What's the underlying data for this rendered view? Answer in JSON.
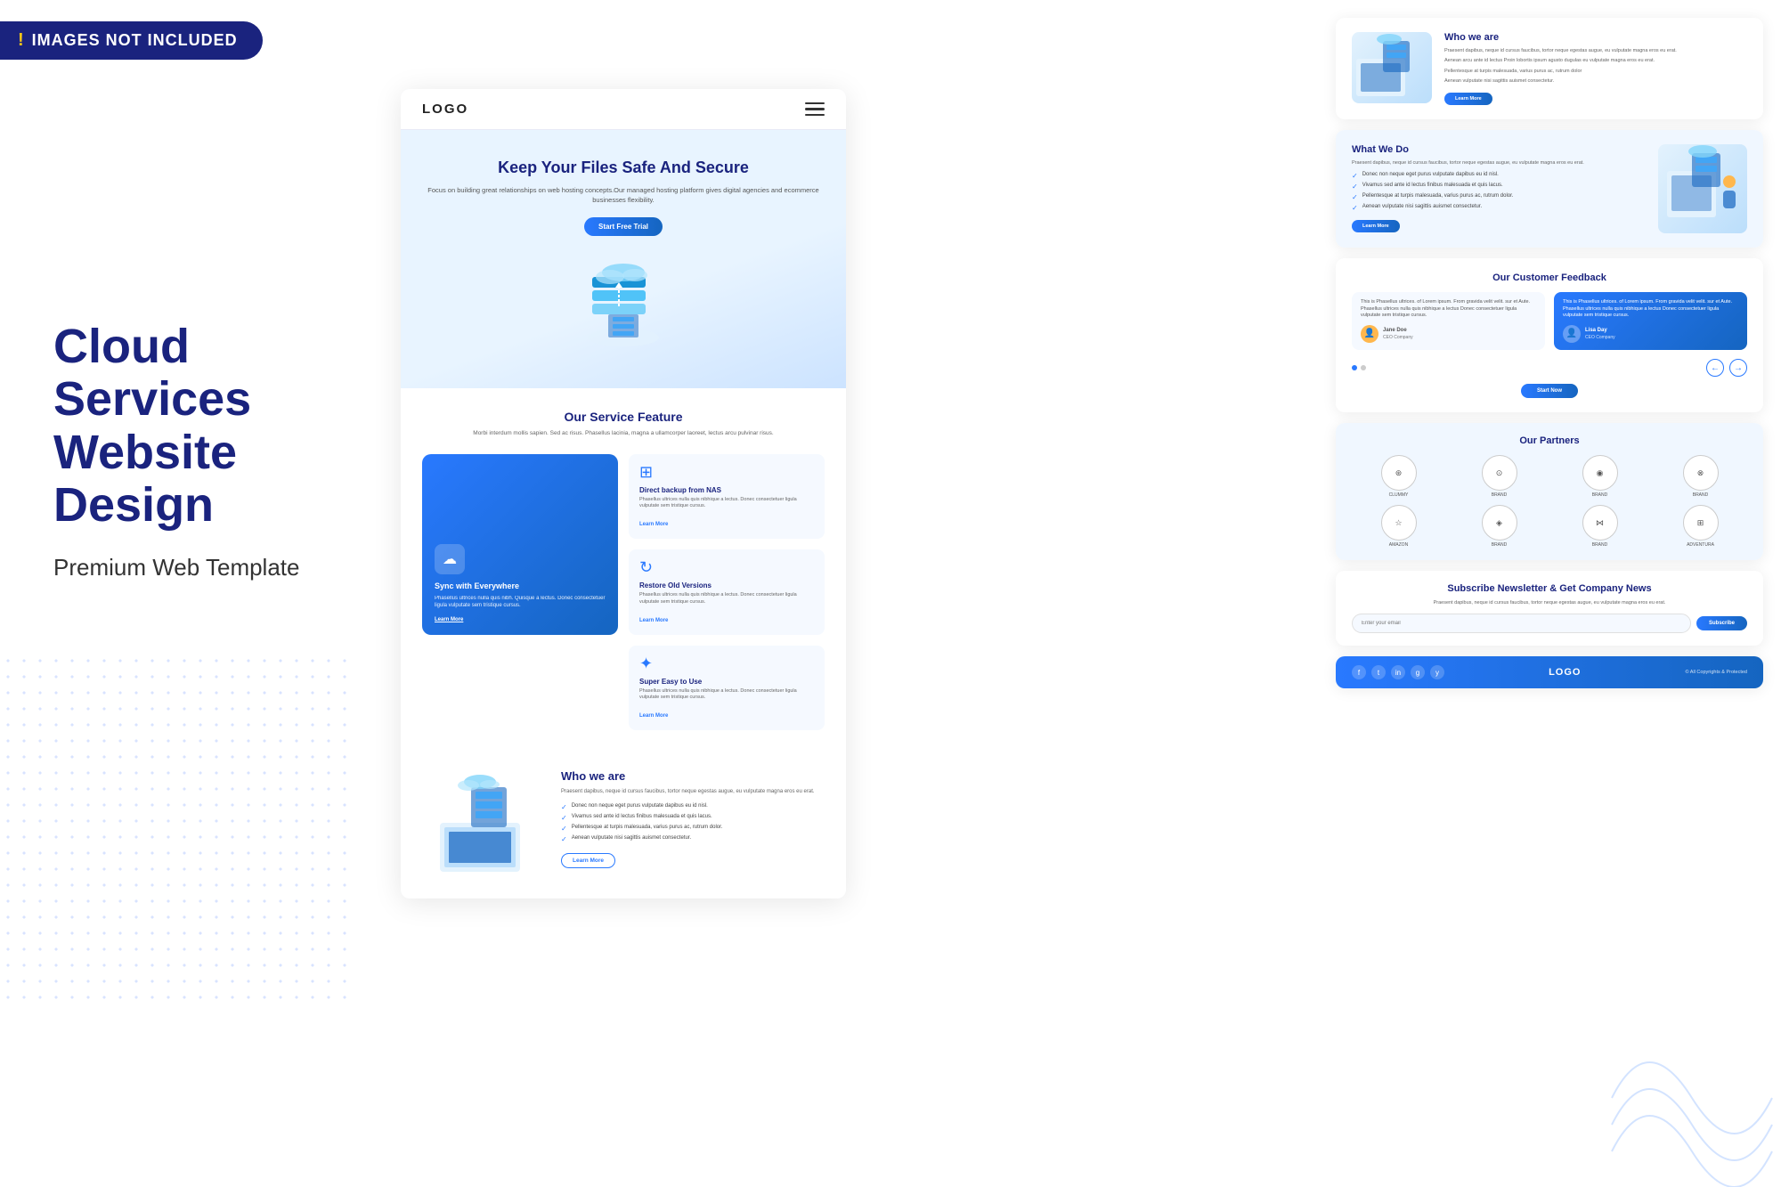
{
  "watermark": {
    "excl": "!",
    "text": "IMAGES NOT INCLUDED"
  },
  "left_panel": {
    "main_title": "Cloud Services\nWebsite Design",
    "sub_title": "Premium Web Template"
  },
  "center_preview": {
    "navbar": {
      "logo": "LOGO",
      "menu_icon": "☰"
    },
    "hero": {
      "title": "Keep Your Files Safe And Secure",
      "subtitle": "Focus on building great relationships on web hosting concepts.Our managed hosting platform gives digital agencies and ecommerce businesses flexibility.",
      "cta_button": "Start Free Trial"
    },
    "service": {
      "title": "Our Service Feature",
      "subtitle": "Morbi interdum mollis sapien. Sed ac risus. Phasellus lacinia, magna a ullamcorper laoreet, lectus arcu pulvinar risus.",
      "cards": [
        {
          "title": "Sync with Everywhere",
          "desc": "Phasellus ultrices nulla quis nibh. Quisque a lectus. Donec consectetuer ligula vulputate sem tristique cursus.",
          "learn_more": "Learn More",
          "featured": true
        },
        {
          "title": "Direct backup from NAS",
          "desc": "Phasellus ultrices nulla quis nibhique a lectus. Donec consectetuer ligula vulputate sem tristique cursus.",
          "learn_more": "Learn More"
        },
        {
          "title": "Restore Old Versions",
          "desc": "Phasellus ultrices nulla quis nibhique a lectus. Donec consectetuer ligula vulputate sem tristique cursus.",
          "learn_more": "Learn More"
        },
        {
          "title": "Super Easy to Use",
          "desc": "Phasellus ultrices nulla quis nibhique a lectus. Donec consectetuer ligula vulputate sem tristique cursus.",
          "learn_more": "Learn More"
        }
      ]
    },
    "who_we_are": {
      "title": "Who we are",
      "subtitle": "Praesent dapibus, neque id cursus faucibus, tortor neque egestas augue, eu vulputate magna eros eu erat.",
      "checklist": [
        "Donec non neque eget purus vulputate dapibus eu id nisl.",
        "Vivamus sed ante id lectus finibus malesuada et quis lacus.",
        "Pellentesque at turpis malesuada, varius purus ac, rutrum dolor.",
        "Aenean vulputate nisi sagittis auismet consectetur."
      ],
      "cta_button": "Learn More"
    }
  },
  "right_column": {
    "who_we_are": {
      "title": "Who we are",
      "paragraphs": [
        "Praesent dapibus, neque id cursus faucibus, tortor neque egestas augue, eu vulputate magna eros eu erat.",
        "Aenean arcu ante id lectus Proin lobortis ipsum agusto dugulas eu vulputate magna eros eu erat.",
        "Pellentesque at turpis malesuada, varius purus ac, rutrum dolor",
        "Aenean vulputate nisi sagittis auismet consectetur."
      ],
      "cta_button": "Learn More"
    },
    "what_we_do": {
      "title": "What We Do",
      "intro": "Praesent dapibus, neque id cursus faucibus, tortor neque egestas augue, eu vulputate magna eros eu erat.",
      "checklist": [
        "Donec non neque eget purus vulputate dapibus eu id nisl.",
        "Vivamus sed ante id lectus finibus malesuada et quis lacus.",
        "Pellentesque at turpis malesuada, varius purus ac, rutrum dolor.",
        "Aenean vulputate nisi sagittis auismet consectetur."
      ],
      "cta_button": "Learn More"
    },
    "feedback": {
      "title": "Our Customer Feedback",
      "cards": [
        {
          "text": "This is Phasellus ultrices. of Lorem ipsum. From gravida velit velit. sur et Aute. Phasellus ultrices nulla quis nibhique a lectus Donec consectetuer ligula vulputate sem tristique cursus.",
          "author": "Jane Doe",
          "role": "CEO Company"
        },
        {
          "text": "This is Phasellus ultrices. of Lorem ipsum. From gravida velit velit. sur et Aute. Phasellus ultrices nulla quis nibhique a lectus Donec consectetuer ligula vulputate sem tristique cursus.",
          "author": "Lisa Day",
          "role": "CEO Company",
          "active": true
        }
      ],
      "dots": [
        1,
        2
      ],
      "cta_button": "Start Now"
    },
    "partners": {
      "title": "Our Partners",
      "logos": [
        {
          "name": "CLUMMY"
        },
        {
          "name": "BRAND"
        },
        {
          "name": "BRAND"
        },
        {
          "name": "BRAND"
        },
        {
          "name": "AMAZON"
        },
        {
          "name": "BRAND"
        },
        {
          "name": "BRAND"
        },
        {
          "name": "ADVENTURA"
        }
      ]
    },
    "newsletter": {
      "title": "Subscribe Newsletter & Get Company News",
      "subtitle": "Praesent dapibus, neque id cursus faucibus, tortor neque egestas augue, eu vulputate magna eros eu erat.",
      "input_placeholder": "Enter your email",
      "cta_button": "Subscribe"
    },
    "footer": {
      "logo": "LOGO",
      "social_icons": [
        "f",
        "t",
        "in",
        "g+",
        "y"
      ],
      "copyright": "© All Copyrights & Protected"
    }
  }
}
